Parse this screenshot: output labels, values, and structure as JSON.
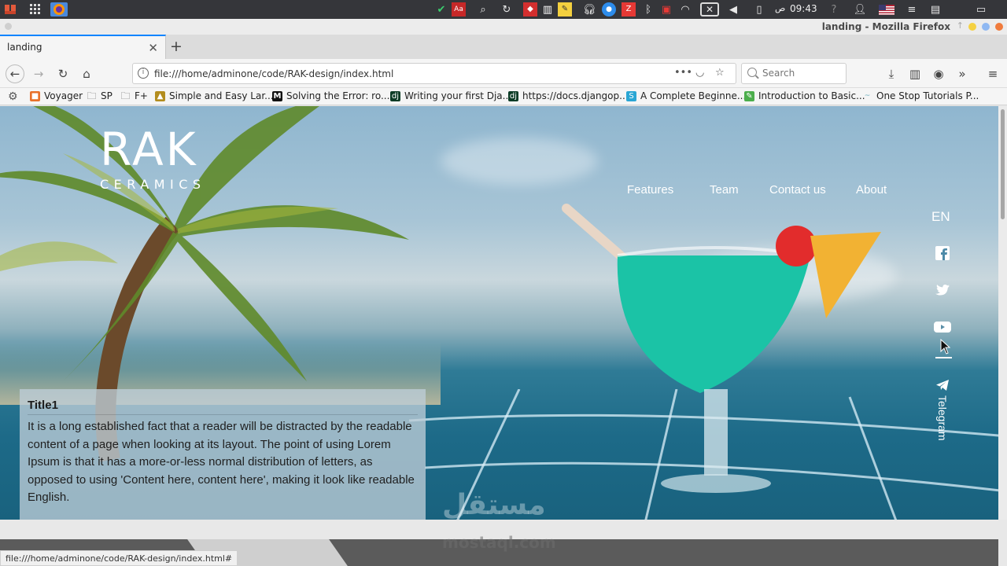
{
  "os_panel": {
    "clock": "09:43",
    "clock_suffix": "ص"
  },
  "window": {
    "title": "landing - Mozilla Firefox"
  },
  "tabs": [
    {
      "label": "landing"
    }
  ],
  "navbar": {
    "url": "file:///home/adminone/code/RAK-design/index.html",
    "search_placeholder": "Search"
  },
  "bookmarks": [
    {
      "label": "Voyager",
      "icon": "voyager-icon"
    },
    {
      "label": "SP",
      "icon": "folder-icon"
    },
    {
      "label": "F+",
      "icon": "folder-icon"
    },
    {
      "label": "Simple and Easy Lar...",
      "icon": "laravel-icon"
    },
    {
      "label": "Solving the Error: ro...",
      "icon": "medium-icon"
    },
    {
      "label": "Writing your first Dja...",
      "icon": "django-icon"
    },
    {
      "label": "https://docs.djangop...",
      "icon": "django-icon"
    },
    {
      "label": "A Complete Beginne...",
      "icon": "s-icon"
    },
    {
      "label": "Introduction to Basic...",
      "icon": "leaf-icon"
    },
    {
      "label": "One Stop Tutorials P...",
      "icon": "tutorial-icon"
    }
  ],
  "page": {
    "logo": {
      "main": "RAK",
      "sub": "CERAMICS"
    },
    "nav": [
      {
        "label": "Features",
        "color": "#ffffff"
      },
      {
        "label": "Team",
        "color": "#ffffff"
      },
      {
        "label": "Contact us",
        "color": "#ffffff"
      },
      {
        "label": "About",
        "color": "#ffffff"
      }
    ],
    "language": "EN",
    "social": [
      "facebook-icon",
      "twitter-icon",
      "youtube-icon",
      "telegram-icon"
    ],
    "telegram_label": "Telegram",
    "card": {
      "title": "Title1",
      "body": "It is a long established fact that a reader will be distracted by the readable content of a page when looking at its layout. The point of using Lorem Ipsum is that it has a more-or-less normal distribution of letters, as opposed to using 'Content here, content here', making it look like readable English."
    }
  },
  "status_bar": {
    "url": "file:///home/adminone/code/RAK-design/index.html#"
  },
  "watermark": {
    "arabic": "مستقل",
    "latin": "mostaql.com"
  },
  "colors": {
    "tab_accent": "#0a84ff",
    "os_panel_bg": "#35363a",
    "accent_red": "#e22c2c"
  }
}
